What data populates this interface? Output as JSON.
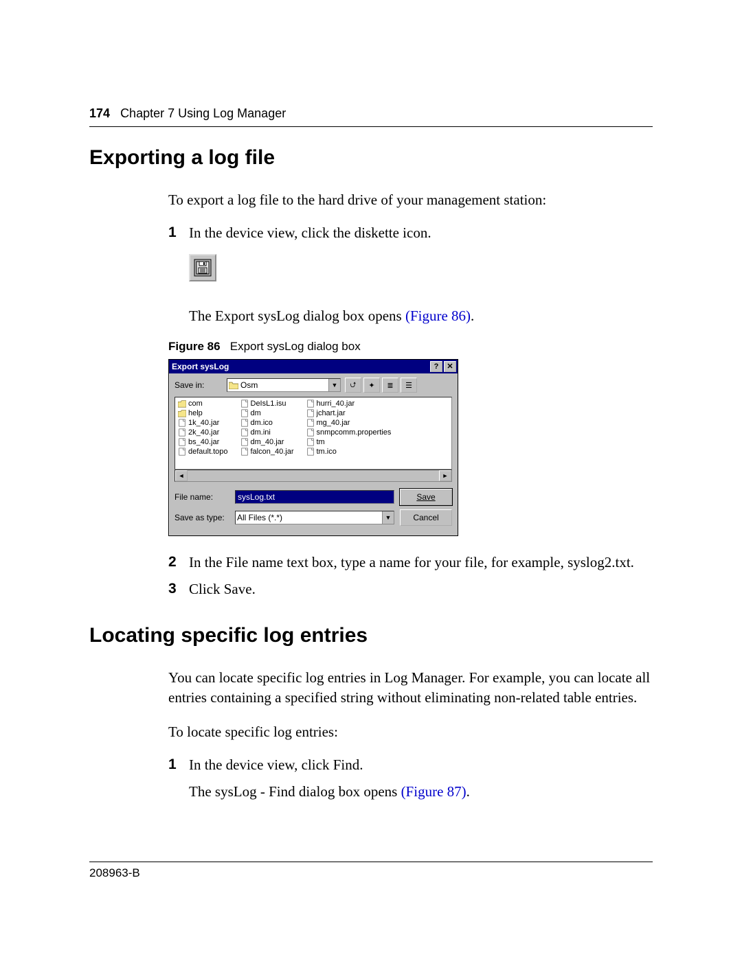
{
  "header": {
    "page_number": "174",
    "chapter_label": "Chapter 7  Using Log Manager"
  },
  "section1": {
    "title": "Exporting a log file",
    "intro": "To export a log file to the hard drive of your management station:",
    "step1": "In the device view, click the diskette icon.",
    "step1_after_prefix": "The Export sysLog dialog box opens ",
    "step1_after_link": "(Figure 86)",
    "step1_after_suffix": ".",
    "figure_label": "Figure 86",
    "figure_caption": "Export sysLog dialog box",
    "step2": "In the File name text box, type a name for your file, for example, syslog2.txt.",
    "step3": "Click Save."
  },
  "dialog": {
    "title": "Export sysLog",
    "help_btn": "?",
    "close_btn": "✕",
    "save_in_label": "Save in:",
    "save_in_value": "Osm",
    "tool_up": "⮍",
    "tool_new": "✦",
    "tool_list": "≣",
    "tool_details": "☰",
    "files_col1": [
      "com",
      "help",
      "1k_40.jar",
      "2k_40.jar",
      "bs_40.jar",
      "default.topo"
    ],
    "files_col2": [
      "DeIsL1.isu",
      "dm",
      "dm.ico",
      "dm.ini",
      "dm_40.jar",
      "falcon_40.jar"
    ],
    "files_col3": [
      "hurri_40.jar",
      "jchart.jar",
      "mg_40.jar",
      "snmpcomm.properties",
      "tm",
      "tm.ico"
    ],
    "file_name_label": "File name:",
    "file_name_value": "sysLog.txt",
    "save_as_type_label": "Save as type:",
    "save_as_type_value": "All Files (*.*)",
    "save_button": "Save",
    "cancel_button": "Cancel"
  },
  "section2": {
    "title": "Locating specific log entries",
    "para1": "You can locate specific log entries in Log Manager. For example, you can locate all entries containing a specified string without eliminating non-related table entries.",
    "para2": "To locate specific log entries:",
    "step1": "In the device view, click Find.",
    "step1_after_prefix": "The sysLog - Find dialog box opens ",
    "step1_after_link": "(Figure 87)",
    "step1_after_suffix": "."
  },
  "footer": {
    "doc_id": "208963-B"
  }
}
